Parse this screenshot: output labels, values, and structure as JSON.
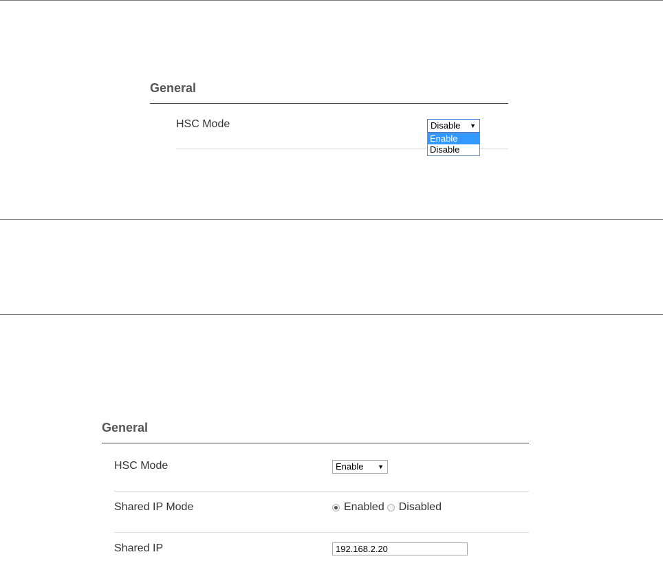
{
  "panel_top": {
    "section_title": "General",
    "hsc_mode": {
      "label": "HSC Mode",
      "selected": "Disable",
      "options": [
        "Enable",
        "Disable"
      ],
      "highlighted_option": "Enable"
    }
  },
  "panel_bottom": {
    "section_title": "General",
    "hsc_mode": {
      "label": "HSC Mode",
      "selected": "Enable"
    },
    "shared_ip_mode": {
      "label": "Shared IP Mode",
      "options": [
        "Enabled",
        "Disabled"
      ],
      "selected": "Enabled"
    },
    "shared_ip": {
      "label": "Shared IP",
      "value": "192.168.2.20"
    }
  },
  "icons": {
    "dropdown_arrow": "▼"
  },
  "colors": {
    "highlight": "#3399ff",
    "separator": "#777777"
  }
}
